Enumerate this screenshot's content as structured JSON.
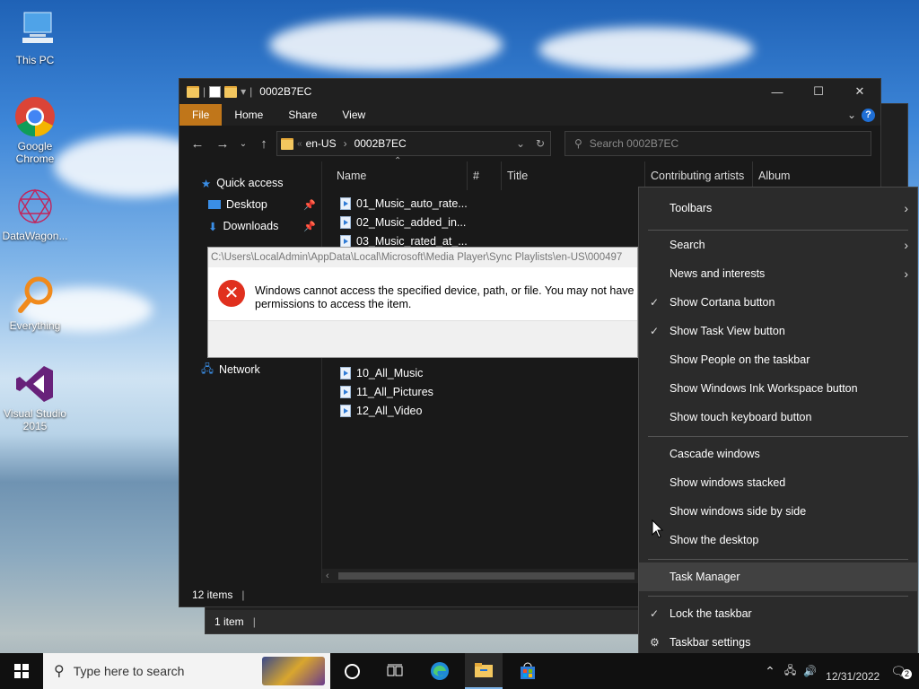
{
  "desktop": {
    "icons": [
      {
        "label": "This PC"
      },
      {
        "label": "Google Chrome"
      },
      {
        "label": "DataWagon..."
      },
      {
        "label": "Everything"
      },
      {
        "label": "Visual Studio 2015"
      }
    ]
  },
  "explorer": {
    "title": "0002B7EC",
    "ribbon_tabs": [
      "File",
      "Home",
      "Share",
      "View"
    ],
    "address": {
      "segments": [
        "en-US",
        "0002B7EC"
      ]
    },
    "search_placeholder": "Search 0002B7EC",
    "nav": {
      "quick_access": "Quick access",
      "desktop": "Desktop",
      "downloads": "Downloads",
      "network": "Network"
    },
    "columns": [
      "Name",
      "#",
      "Title",
      "Contributing artists",
      "Album"
    ],
    "files": [
      "01_Music_auto_rate...",
      "02_Music_added_in...",
      "03_Music_rated_at_...",
      "10_All_Music",
      "11_All_Pictures",
      "12_All_Video"
    ],
    "status": "12 items"
  },
  "explorer_back": {
    "status": "1 item"
  },
  "error_dialog": {
    "path": "C:\\Users\\LocalAdmin\\AppData\\Local\\Microsoft\\Media Player\\Sync Playlists\\en-US\\000497",
    "message_line1": "Windows cannot access the specified device, path, or file. You may not have the a",
    "message_line2": "permissions to access the item."
  },
  "context_menu": {
    "toolbars": "Toolbars",
    "search": "Search",
    "news": "News and interests",
    "cortana": "Show Cortana button",
    "taskview": "Show Task View button",
    "people": "Show People on the taskbar",
    "ink": "Show Windows Ink Workspace button",
    "touch": "Show touch keyboard button",
    "cascade": "Cascade windows",
    "stacked": "Show windows stacked",
    "side": "Show windows side by side",
    "desktop": "Show the desktop",
    "taskmgr": "Task Manager",
    "lock": "Lock the taskbar",
    "settings": "Taskbar settings"
  },
  "taskbar": {
    "search_placeholder": "Type here to search",
    "date": "12/31/2022"
  },
  "colors": {
    "file_tab": "#c0761a",
    "error_red": "#e0301e",
    "menu_bg": "#2b2b2b",
    "taskbar_bg": "#101010"
  }
}
